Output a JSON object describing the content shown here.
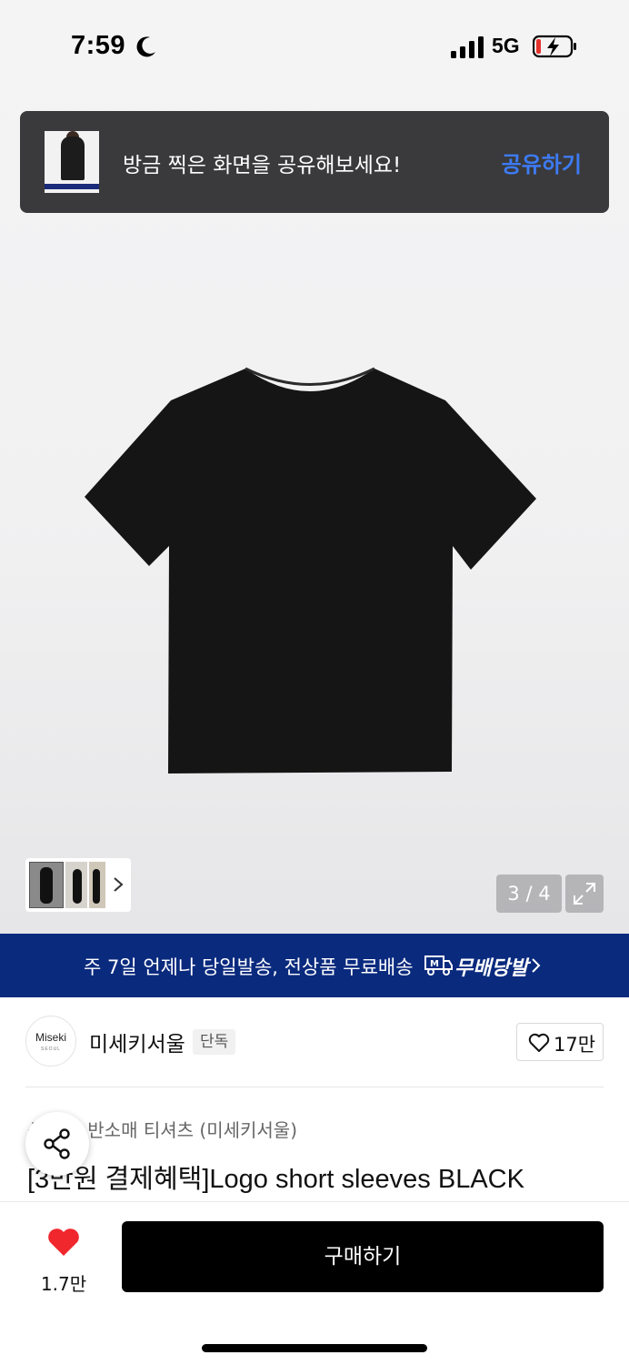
{
  "status_bar": {
    "time": "7:59",
    "network": "5G"
  },
  "share_toast": {
    "message": "방금 찍은 화면을 공유해보세요!",
    "action_label": "공유하기"
  },
  "gallery": {
    "page_indicator": "3 / 4"
  },
  "promo_banner": {
    "text": "주 7일 언제나 당일발송, 전상품 무료배송",
    "brand": "무배당발"
  },
  "store": {
    "logo_text": "Miseki",
    "logo_sub": "SEOUL",
    "name": "미세키서울",
    "badge": "단독",
    "like_count": "17만"
  },
  "product": {
    "category_path": "상의 > 반소매 티셔츠 (미세키서울)",
    "title": "[3만원 결제혜택]Logo short sleeves BLACK"
  },
  "bottom_bar": {
    "like_count": "1.7만",
    "buy_label": "구매하기"
  },
  "colors": {
    "accent_blue": "#3d7bf5",
    "banner_navy": "#0a2a7e",
    "heart_red": "#f0272d"
  }
}
